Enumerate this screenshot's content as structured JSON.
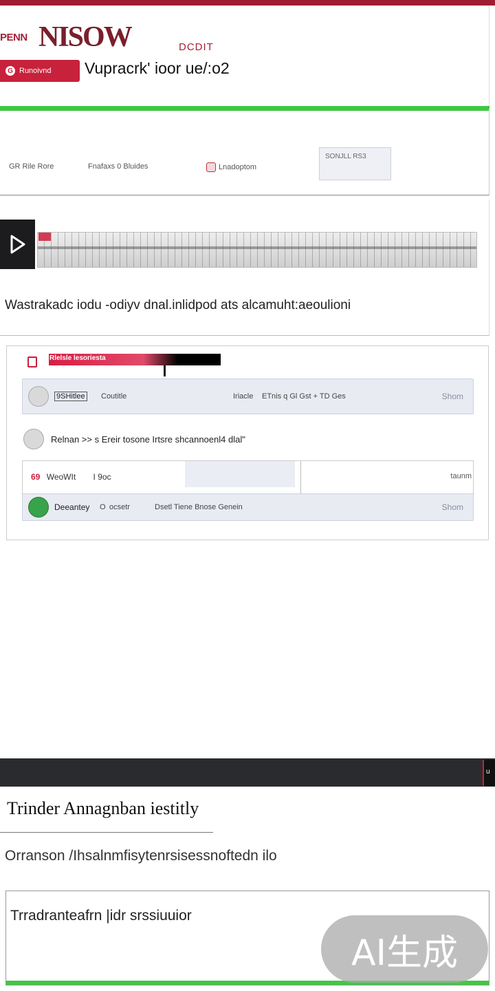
{
  "header": {
    "logo_small": "PENN",
    "logo_big": "NISOW",
    "logo_sub": "DCDIT",
    "tag_button": "Runoivnd",
    "tag_badge": "G",
    "title": "Vupracrk' ioor ue/:o2"
  },
  "tabs": [
    {
      "label": "GR Rile Rore"
    },
    {
      "label": "Fnafaxs 0 Bluides"
    },
    {
      "label": "Lnadoptom"
    },
    {
      "label": "SONJLL RS3"
    }
  ],
  "video": {
    "caption": "Wastrakadc iodu -odiyv dnal.inlidpod ats alcamuht:aeoulioni"
  },
  "list_panel": {
    "bar_label": "Rlelsle lesoriesta",
    "rows": [
      {
        "name": "9SHitlee",
        "col1": "Coutitle",
        "col2": "Iriacle",
        "col3": "ETnis q Gl Gst + TD Ges",
        "action": "Shom"
      },
      {
        "name": "Relnan >> s Ereir tosone Irtsre shcannoenl4 dlal\""
      },
      {
        "mark": "69",
        "name": "WeoWIt",
        "col1": "I 9oc",
        "right": "taunm"
      },
      {
        "name": "Deeantey",
        "col1": "O",
        "col2": "ocsetr",
        "col3": "Dsetl Tiene Bnose Genein",
        "action": "Shom"
      }
    ]
  },
  "lower": {
    "badge_text": "u",
    "title": "Trinder Annagnban iestitly",
    "subtitle": "Orranson /Ihsalnmfisytenrsisessnoftedn ilo",
    "text_box_label": "Trradranteafrn |idr srssiuuior"
  },
  "watermark": "AI生成",
  "colors": {
    "brand": "#c8213b",
    "accent_green": "#3fc842",
    "dark_band": "#2a2b2e"
  }
}
